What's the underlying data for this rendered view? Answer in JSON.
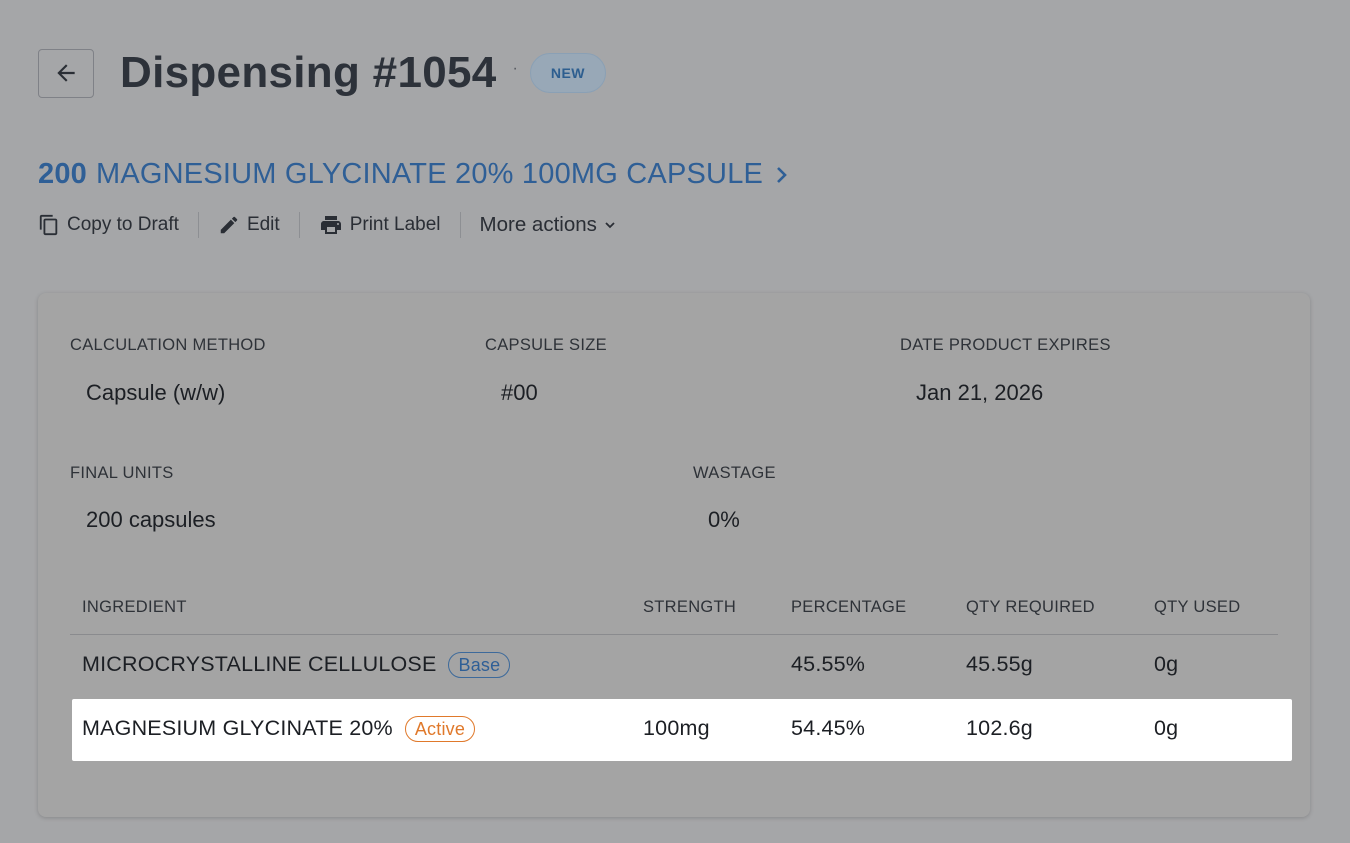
{
  "header": {
    "title": "Dispensing #1054",
    "separator": "·",
    "status": "NEW"
  },
  "product": {
    "quantity": "200",
    "name": "MAGNESIUM GLYCINATE 20% 100MG CAPSULE"
  },
  "actions": {
    "copy_to_draft": "Copy to Draft",
    "edit": "Edit",
    "print_label": "Print Label",
    "more_actions": "More actions"
  },
  "details": {
    "calculation_method": {
      "label": "CALCULATION METHOD",
      "value": "Capsule (w/w)"
    },
    "capsule_size": {
      "label": "CAPSULE SIZE",
      "value": "#00"
    },
    "date_expires": {
      "label": "DATE PRODUCT EXPIRES",
      "value": "Jan 21, 2026"
    },
    "final_units": {
      "label": "FINAL UNITS",
      "value": "200 capsules"
    },
    "wastage": {
      "label": "WASTAGE",
      "value": "0%"
    }
  },
  "table": {
    "columns": [
      "INGREDIENT",
      "STRENGTH",
      "PERCENTAGE",
      "QTY REQUIRED",
      "QTY USED"
    ],
    "rows": [
      {
        "ingredient": "MICROCRYSTALLINE CELLULOSE",
        "tag": "Base",
        "strength": "",
        "percentage": "45.55%",
        "qty_required": "45.55g",
        "qty_used": "0g"
      },
      {
        "ingredient": "MAGNESIUM GLYCINATE 20%",
        "tag": "Active",
        "strength": "100mg",
        "percentage": "54.45%",
        "qty_required": "102.6g",
        "qty_used": "0g"
      }
    ]
  },
  "colors": {
    "page_background": "#a5a6a8",
    "link_blue": "#2f5f96",
    "active_orange": "#e0792b",
    "highlight_row": "#ffffff"
  },
  "icons": [
    "back-arrow-icon",
    "chevron-right-icon",
    "copy-icon",
    "pencil-icon",
    "printer-icon",
    "chevron-down-icon"
  ]
}
